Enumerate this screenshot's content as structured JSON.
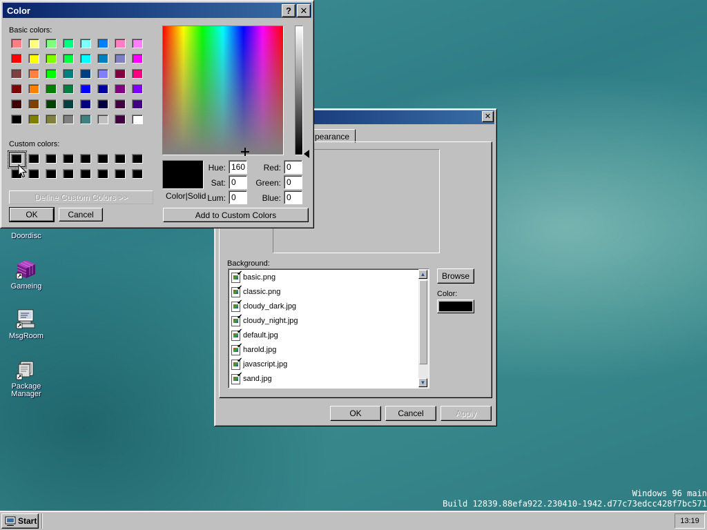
{
  "desktop": {
    "icons": [
      {
        "label": "Doordisc",
        "icon": "disc-icon"
      },
      {
        "label": "Gameing",
        "icon": "cube-icon"
      },
      {
        "label": "MsgRoom",
        "icon": "chat-icon"
      },
      {
        "label": "Package Manager",
        "icon": "package-icon"
      }
    ],
    "watermark": {
      "line1": "Windows 96 main",
      "line2": "Build 12839.88efa922.230410-1942.d77c73edcc428f7bc571"
    }
  },
  "color_dialog": {
    "title": "Color",
    "help_button": "?",
    "close_button": "✕",
    "basic_colors_label": "Basic colors:",
    "basic_colors": [
      "#ff8080",
      "#ffff80",
      "#80ff80",
      "#00ff80",
      "#80ffff",
      "#0080ff",
      "#ff80c0",
      "#ff80ff",
      "#ff0000",
      "#ffff00",
      "#80ff00",
      "#00ff40",
      "#00ffff",
      "#0080c0",
      "#8080c0",
      "#ff00ff",
      "#804040",
      "#ff8040",
      "#00ff00",
      "#008080",
      "#004080",
      "#8080ff",
      "#800040",
      "#ff0080",
      "#800000",
      "#ff8000",
      "#008000",
      "#008040",
      "#0000ff",
      "#0000a0",
      "#800080",
      "#8000ff",
      "#400000",
      "#804000",
      "#004000",
      "#004040",
      "#000080",
      "#000040",
      "#400040",
      "#400080",
      "#000000",
      "#808000",
      "#808040",
      "#808080",
      "#408080",
      "#c0c0c0",
      "#400040",
      "#ffffff"
    ],
    "custom_colors_label": "Custom colors:",
    "custom_colors": [
      "#000000",
      "#000000",
      "#000000",
      "#000000",
      "#000000",
      "#000000",
      "#000000",
      "#000000",
      "#000000",
      "#000000",
      "#000000",
      "#000000",
      "#000000",
      "#000000",
      "#000000",
      "#000000"
    ],
    "define_custom_button": "Define Custom Colors >>",
    "ok_button": "OK",
    "cancel_button": "Cancel",
    "color_solid_label": "Color|Solid",
    "preview_color": "#000000",
    "fields": {
      "hue": {
        "label": "Hue:",
        "value": "160"
      },
      "sat": {
        "label": "Sat:",
        "value": "0"
      },
      "lum": {
        "label": "Lum:",
        "value": "0"
      },
      "red": {
        "label": "Red:",
        "value": "0"
      },
      "green": {
        "label": "Green:",
        "value": "0"
      },
      "blue": {
        "label": "Blue:",
        "value": "0"
      }
    },
    "add_custom_button": "Add to Custom Colors"
  },
  "display_dialog": {
    "close_button": "✕",
    "tab_label": "pearance",
    "background_label": "Background:",
    "files": [
      "basic.png",
      "classic.png",
      "cloudy_dark.jpg",
      "cloudy_night.jpg",
      "default.jpg",
      "harold.jpg",
      "javascript.jpg",
      "sand.jpg"
    ],
    "browse_button": "Browse",
    "color_label": "Color:",
    "color_value": "#000000",
    "ok_button": "OK",
    "cancel_button": "Cancel",
    "apply_button": "Apply"
  },
  "taskbar": {
    "start_label": "Start",
    "clock": "13:19"
  },
  "colors": {
    "titlebar_active": "#0a246a",
    "titlebar_active_end": "#3a6ea5",
    "titlebar_inactive": "#0a246a"
  }
}
